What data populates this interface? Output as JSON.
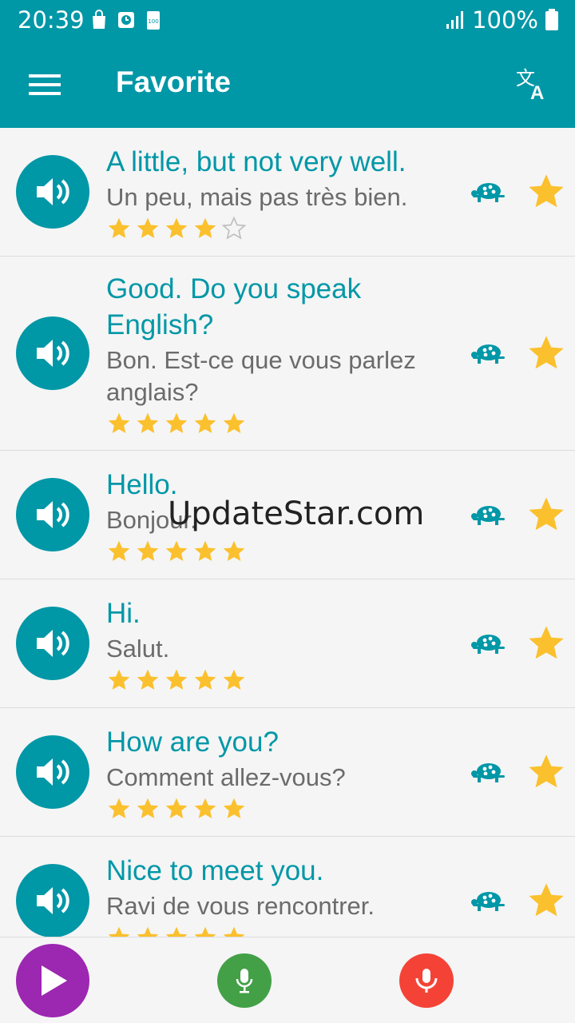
{
  "status_bar": {
    "time": "20:39",
    "battery": "100%"
  },
  "app_bar": {
    "title": "Favorite"
  },
  "items": [
    {
      "en": "A little, but not very well.",
      "fr": "Un peu, mais pas très bien.",
      "rating": 4,
      "favorite": true
    },
    {
      "en": "Good. Do you speak English?",
      "fr": "Bon. Est-ce que vous parlez anglais?",
      "rating": 5,
      "favorite": true
    },
    {
      "en": "Hello.",
      "fr": "Bonjour.",
      "rating": 5,
      "favorite": true
    },
    {
      "en": "Hi.",
      "fr": "Salut.",
      "rating": 5,
      "favorite": true
    },
    {
      "en": "How are you?",
      "fr": "Comment allez-vous?",
      "rating": 5,
      "favorite": true
    },
    {
      "en": "Nice to meet you.",
      "fr": "Ravi de vous rencontrer.",
      "rating": 5,
      "favorite": true
    }
  ],
  "watermark": "UpdateStar.com",
  "colors": {
    "primary": "#0097a7",
    "star": "#fbc02d",
    "play": "#9c27b0",
    "mic_green": "#43a047",
    "mic_red": "#f44336"
  }
}
